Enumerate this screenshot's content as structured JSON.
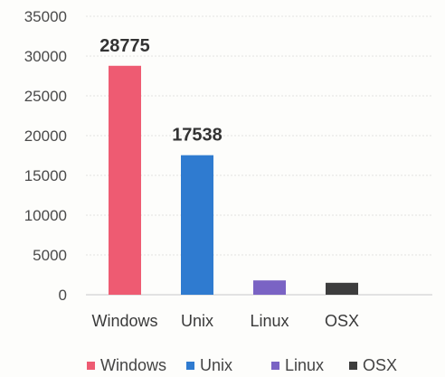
{
  "chart_data": {
    "type": "bar",
    "categories": [
      "Windows",
      "Unix",
      "Linux",
      "OSX"
    ],
    "values": [
      28775,
      17538,
      1800,
      1500
    ],
    "data_labels": [
      "28775",
      "17538",
      "",
      ""
    ],
    "colors": [
      "#ee5b72",
      "#2f7bd0",
      "#7a63c4",
      "#3d3d3d"
    ],
    "ylim": [
      0,
      35000
    ],
    "yticks": [
      0,
      5000,
      10000,
      15000,
      20000,
      25000,
      30000,
      35000
    ],
    "grid": true,
    "legend": {
      "position": "bottom",
      "entries": [
        "Windows",
        "Unix",
        "Linux",
        "OSX"
      ]
    },
    "title": "",
    "xlabel": "",
    "ylabel": ""
  }
}
